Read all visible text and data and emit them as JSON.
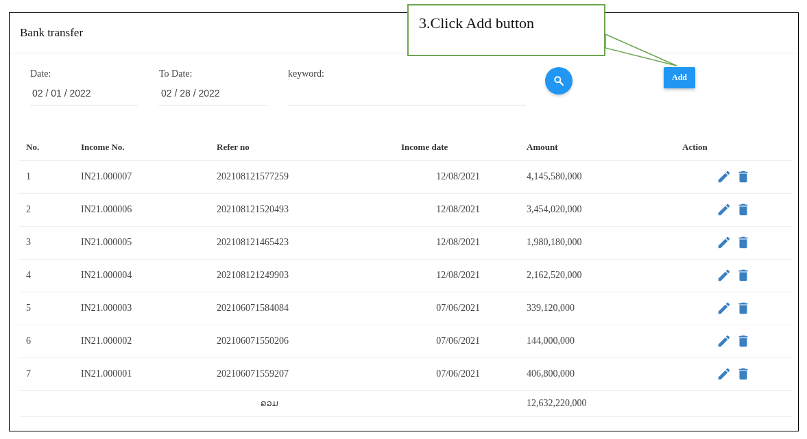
{
  "callout": {
    "text": "3.Click Add button"
  },
  "card": {
    "title": "Bank transfer"
  },
  "filters": [
    {
      "label": "Date:",
      "value": "02 / 01 / 2022"
    },
    {
      "label": "To Date:",
      "value": "02 / 28 / 2022"
    },
    {
      "label": "keyword:"
    }
  ],
  "add_button": {
    "label": "Add"
  },
  "table": {
    "columns": [
      "No.",
      "Income No.",
      "Refer no",
      "Income date",
      "Amount",
      "Action"
    ],
    "rows": [
      {
        "no": "1",
        "income_no": "IN21.000007",
        "refer_no": "202108121577259",
        "income_date": "12/08/2021",
        "amount": "4,145,580,000"
      },
      {
        "no": "2",
        "income_no": "IN21.000006",
        "refer_no": "202108121520493",
        "income_date": "12/08/2021",
        "amount": "3,454,020,000"
      },
      {
        "no": "3",
        "income_no": "IN21.000005",
        "refer_no": "202108121465423",
        "income_date": "12/08/2021",
        "amount": "1,980,180,000"
      },
      {
        "no": "4",
        "income_no": "IN21.000004",
        "refer_no": "202108121249903",
        "income_date": "12/08/2021",
        "amount": "2,162,520,000"
      },
      {
        "no": "5",
        "income_no": "IN21.000003",
        "refer_no": "202106071584084",
        "income_date": "07/06/2021",
        "amount": "339,120,000"
      },
      {
        "no": "6",
        "income_no": "IN21.000002",
        "refer_no": "202106071550206",
        "income_date": "07/06/2021",
        "amount": "144,000,000"
      },
      {
        "no": "7",
        "income_no": "IN21.000001",
        "refer_no": "202106071559207",
        "income_date": "07/06/2021",
        "amount": "406,800,000"
      }
    ],
    "total": {
      "label": "ລວມ",
      "amount": "12,632,220,000"
    }
  }
}
